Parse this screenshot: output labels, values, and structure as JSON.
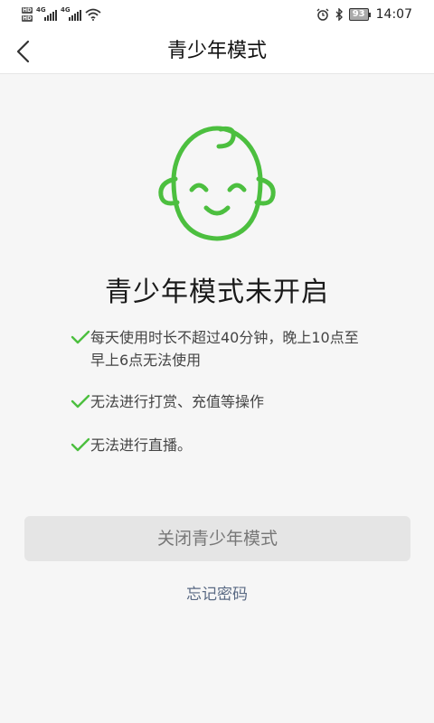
{
  "status_bar": {
    "network_tag_1": "HD",
    "network_tag_2": "HD",
    "network_type_1": "4G",
    "network_type_2": "4G",
    "battery": "93",
    "time": "14:07"
  },
  "nav": {
    "back_icon": "chevron-left-icon",
    "title": "青少年模式"
  },
  "main": {
    "illustration_icon": "baby-face-icon",
    "accent_color": "#4cbf3f",
    "title": "青少年模式未开启",
    "rules": [
      "每天使用时长不超过40分钟，晚上10点至早上6点无法使用",
      "无法进行打赏、充值等操作",
      "无法进行直播。"
    ],
    "close_button": "关闭青少年模式",
    "forgot_password": "忘记密码"
  }
}
